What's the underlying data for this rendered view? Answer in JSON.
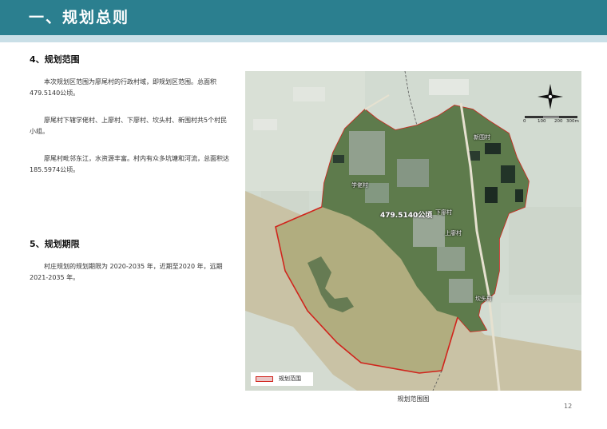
{
  "header": {
    "title": "一、规划总则"
  },
  "section_scope": {
    "title": "4、规划范围",
    "paragraphs": [
      "本次规划区范围为廖尾村的行政村域，即规划区范围。总面积479.5140公顷。",
      "廖尾村下辖学佬村、上廖村、下廖村、坎头村、新围村共5个村民小组。",
      "廖尾村毗邻东江，水资源丰富。村内有众多坑塘和河流，总面积达185.5974公顷。"
    ]
  },
  "section_period": {
    "title": "5、规划期限",
    "paragraphs": [
      "村庄规划的规划期限为 2020-2035 年，近期至2020 年，远期 2021-2035 年。"
    ]
  },
  "map": {
    "caption": "规划范围图",
    "area_label": "479.5140公顷",
    "villages": [
      "新围村",
      "学佬村",
      "下廖村",
      "上廖村",
      "坎头村"
    ],
    "legend_label": "规划范围",
    "scale_labels": [
      "0",
      "100",
      "200",
      "300m"
    ],
    "boundary_color": "#d0241c",
    "river_color": "#ad9f6e"
  },
  "page_number": "12"
}
